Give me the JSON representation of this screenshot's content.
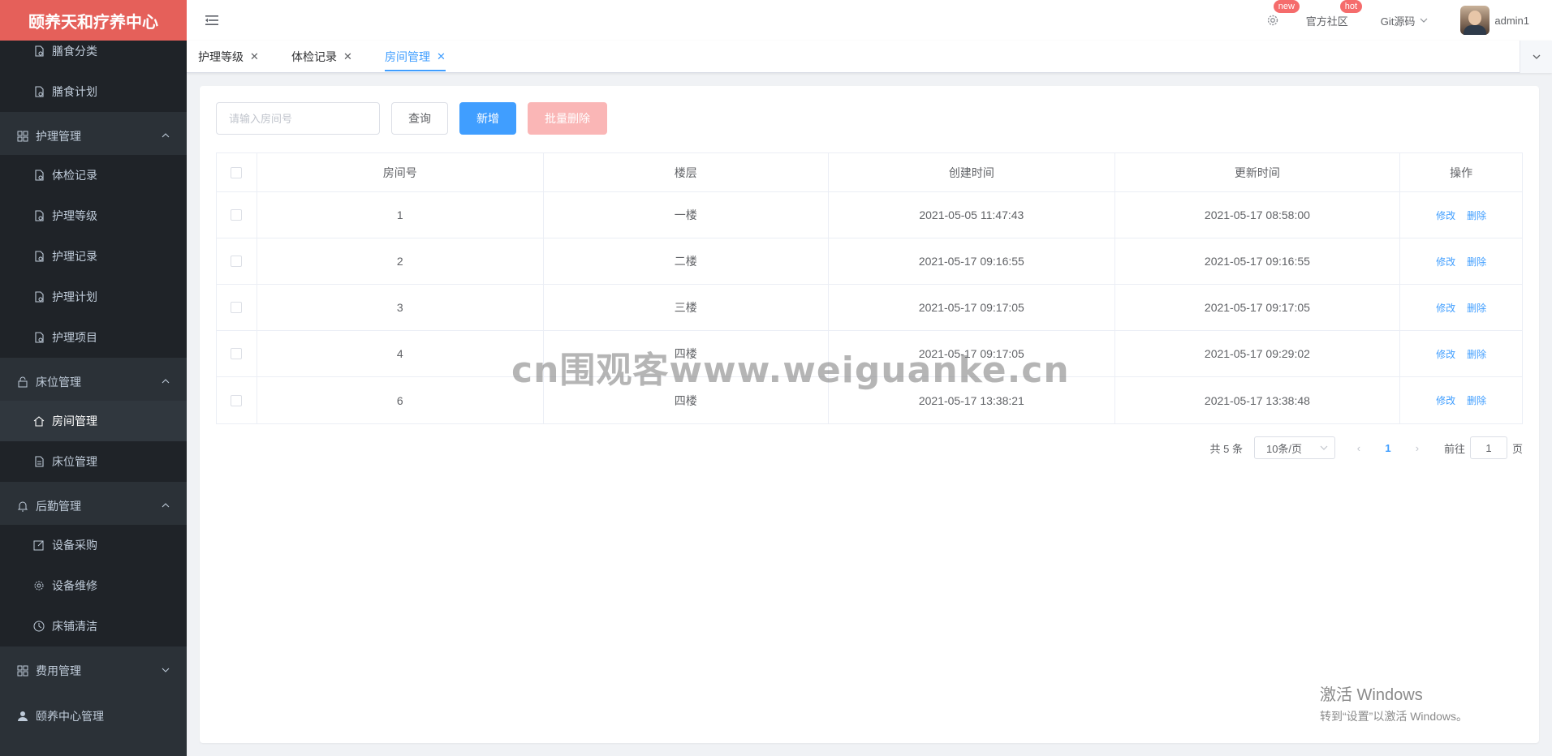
{
  "app": {
    "title": "颐养天和疗养中心"
  },
  "sidebar": {
    "items": [
      {
        "label": "膳食分类",
        "icon": "document-icon",
        "level": "sub"
      },
      {
        "label": "膳食计划",
        "icon": "document-icon",
        "level": "sub"
      },
      {
        "label": "护理管理",
        "icon": "grid-icon",
        "level": "top",
        "expanded": true
      },
      {
        "label": "体检记录",
        "icon": "document-icon",
        "level": "sub"
      },
      {
        "label": "护理等级",
        "icon": "document-icon",
        "level": "sub"
      },
      {
        "label": "护理记录",
        "icon": "document-icon",
        "level": "sub"
      },
      {
        "label": "护理计划",
        "icon": "document-icon",
        "level": "sub"
      },
      {
        "label": "护理项目",
        "icon": "document-icon",
        "level": "sub"
      },
      {
        "label": "床位管理",
        "icon": "lock-icon",
        "level": "top",
        "expanded": true
      },
      {
        "label": "房间管理",
        "icon": "home-icon",
        "level": "sub",
        "active": true
      },
      {
        "label": "床位管理",
        "icon": "file-icon",
        "level": "sub"
      },
      {
        "label": "后勤管理",
        "icon": "bell-icon",
        "level": "top",
        "expanded": true
      },
      {
        "label": "设备采购",
        "icon": "edit-icon",
        "level": "sub"
      },
      {
        "label": "设备维修",
        "icon": "gear-icon",
        "level": "sub"
      },
      {
        "label": "床铺清洁",
        "icon": "clock-icon",
        "level": "sub"
      },
      {
        "label": "费用管理",
        "icon": "grid-icon",
        "level": "top",
        "expanded": false
      },
      {
        "label": "颐养中心管理",
        "icon": "user-icon",
        "level": "top"
      }
    ]
  },
  "navbar": {
    "settings_badge": "new",
    "community_label": "官方社区",
    "community_badge": "hot",
    "git_label": "Git源码",
    "user_name": "admin1"
  },
  "tabs": [
    {
      "label": "护理等级",
      "active": false
    },
    {
      "label": "体检记录",
      "active": false
    },
    {
      "label": "房间管理",
      "active": true
    }
  ],
  "toolbar": {
    "search_placeholder": "请输入房间号",
    "query_label": "查询",
    "add_label": "新增",
    "batch_delete_label": "批量删除"
  },
  "table": {
    "headers": [
      "房间号",
      "楼层",
      "创建时间",
      "更新时间",
      "操作"
    ],
    "edit_label": "修改",
    "delete_label": "删除",
    "rows": [
      {
        "room": "1",
        "floor": "一楼",
        "created": "2021-05-05 11:47:43",
        "updated": "2021-05-17 08:58:00"
      },
      {
        "room": "2",
        "floor": "二楼",
        "created": "2021-05-17 09:16:55",
        "updated": "2021-05-17 09:16:55"
      },
      {
        "room": "3",
        "floor": "三楼",
        "created": "2021-05-17 09:17:05",
        "updated": "2021-05-17 09:17:05"
      },
      {
        "room": "4",
        "floor": "四楼",
        "created": "2021-05-17 09:17:05",
        "updated": "2021-05-17 09:29:02"
      },
      {
        "room": "6",
        "floor": "四楼",
        "created": "2021-05-17 13:38:21",
        "updated": "2021-05-17 13:38:48"
      }
    ]
  },
  "pagination": {
    "total_text": "共 5 条",
    "page_size": "10条/页",
    "current_page": "1",
    "goto_label": "前往",
    "goto_value": "1",
    "page_suffix": "页"
  },
  "watermark": "cn围观客www.weiguanke.cn",
  "activation": {
    "title": "激活 Windows",
    "subtitle": "转到“设置”以激活 Windows。"
  },
  "colors": {
    "primary": "#409eff",
    "danger_light": "#fab6b6",
    "logo_bg": "#e5605a",
    "sidebar_bg": "#2b3137"
  }
}
